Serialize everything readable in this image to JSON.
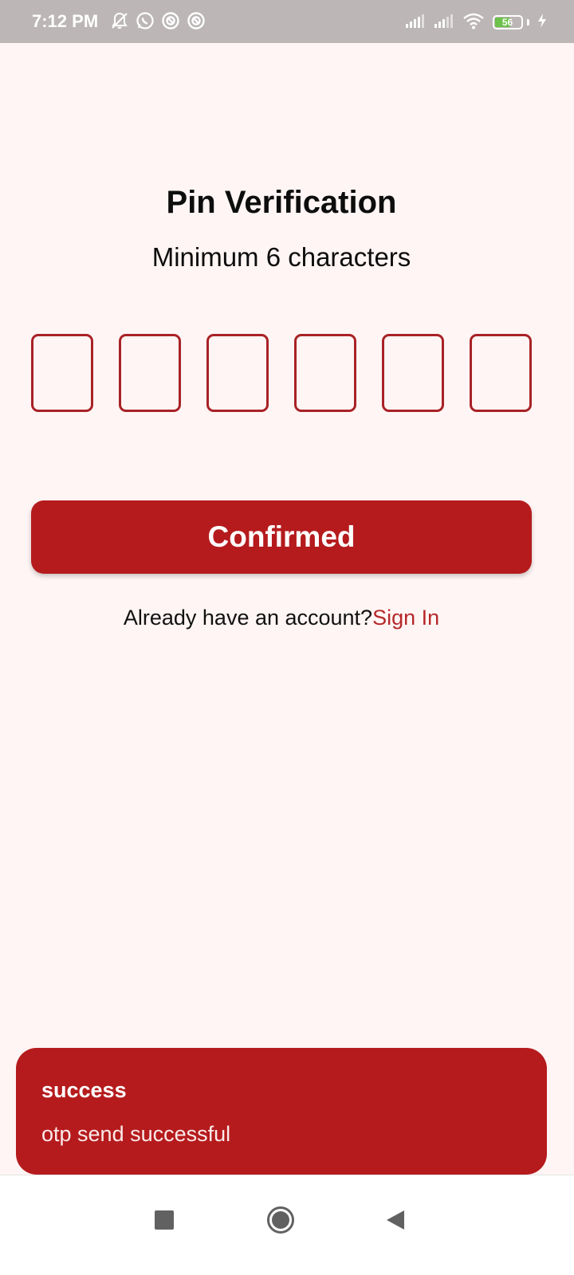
{
  "status_bar": {
    "time": "7:12 PM",
    "battery_level": "56",
    "left_icons": [
      "notifications-off-icon",
      "whatsapp-icon",
      "app-icon",
      "app-icon"
    ],
    "right_icons": [
      "signal-icon",
      "signal-icon",
      "wifi-icon",
      "battery-icon",
      "charging-icon"
    ]
  },
  "page": {
    "title": "Pin Verification",
    "subtitle": "Minimum 6 characters"
  },
  "pin": {
    "length": 6,
    "values": [
      "",
      "",
      "",
      "",
      "",
      ""
    ]
  },
  "confirm_button": {
    "label": "Confirmed"
  },
  "signin": {
    "prompt": "Already have an account?",
    "link_label": "Sign In"
  },
  "snackbar": {
    "title": "success",
    "message": "otp send successful"
  },
  "nav_bar": {
    "buttons": [
      "recent-apps-icon",
      "home-icon",
      "back-icon"
    ]
  },
  "colors": {
    "accent": "#b51b1d",
    "background": "#fff5f4",
    "status_bar": "#bcb6b6"
  }
}
